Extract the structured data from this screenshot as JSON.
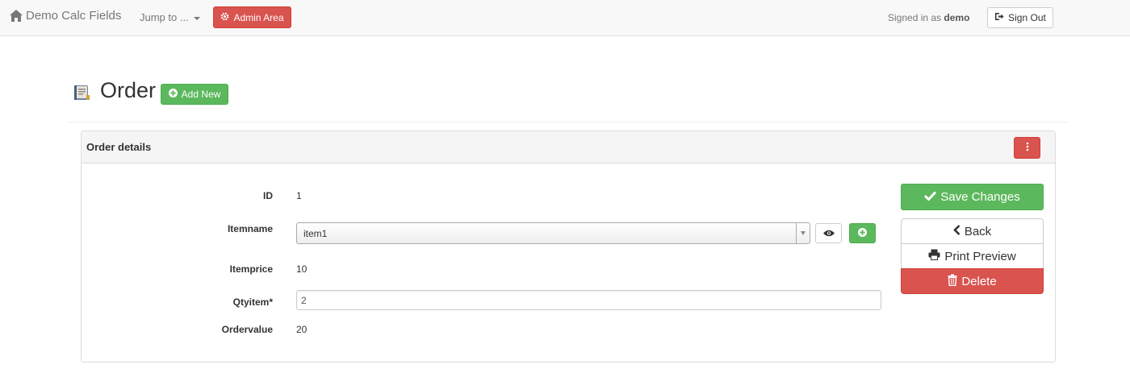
{
  "navbar": {
    "brand": "Demo Calc Fields",
    "jump_to": "Jump to ...",
    "admin_area": "Admin Area",
    "signed_in_prefix": "Signed in as",
    "username": "demo",
    "sign_out": "Sign Out"
  },
  "page": {
    "title": "Order",
    "add_new": "Add New"
  },
  "panel": {
    "title": "Order details"
  },
  "form": {
    "id_label": "ID",
    "id_value": "1",
    "itemname_label": "Itemname",
    "itemname_value": "item1",
    "itemprice_label": "Itemprice",
    "itemprice_value": "10",
    "qtyitem_label": "Qtyitem*",
    "qtyitem_value": "2",
    "ordervalue_label": "Ordervalue",
    "ordervalue_value": "20"
  },
  "actions": {
    "save": "Save Changes",
    "back": "Back",
    "print_preview": "Print Preview",
    "delete": "Delete"
  },
  "colors": {
    "danger": "#d9534f",
    "success": "#5cb85c",
    "navbar_bg": "#f8f8f8",
    "panel_heading_bg": "#f5f5f5"
  },
  "icons": {
    "brand": "home-icon",
    "admin": "cog-icon",
    "sign_out": "log-out-icon",
    "page": "order-book-icon",
    "add_new": "plus-circle-icon",
    "panel_menu": "vertical-ellipsis-icon",
    "view": "eye-icon",
    "add_item": "plus-circle-icon",
    "save": "check-icon",
    "back": "chevron-left-icon",
    "print": "print-icon",
    "delete": "trash-icon"
  }
}
